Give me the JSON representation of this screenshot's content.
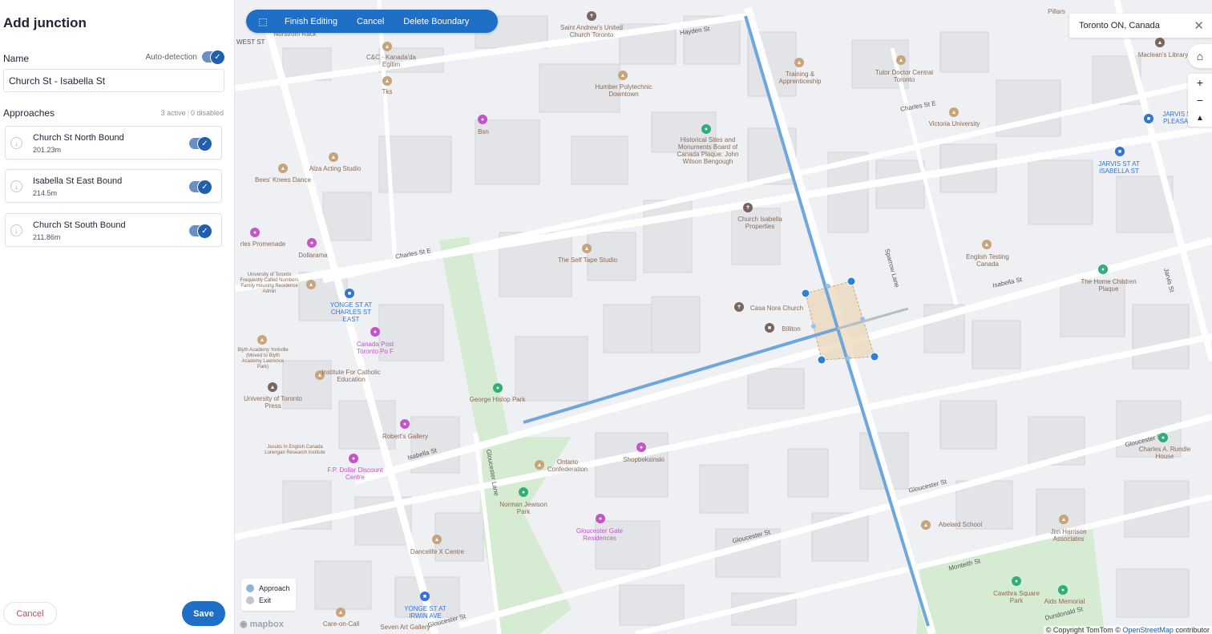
{
  "sidebar": {
    "title": "Add junction",
    "name_label": "Name",
    "auto_detection_label": "Auto-detection",
    "name_value": "Church St - Isabella St",
    "approaches_label": "Approaches",
    "active_count": "3 active",
    "disabled_count": "0 disabled",
    "approaches": [
      {
        "name": "Church St North Bound",
        "distance": "201.23m",
        "enabled": true
      },
      {
        "name": "Isabella St East Bound",
        "distance": "214.5m",
        "enabled": true
      },
      {
        "name": "Church St South Bound",
        "distance": "211.86m",
        "enabled": true
      }
    ],
    "cancel_label": "Cancel",
    "save_label": "Save"
  },
  "toolbar": {
    "finish_label": "Finish Editing",
    "cancel_label": "Cancel",
    "delete_label": "Delete Boundary"
  },
  "search": {
    "value": "Toronto ON, Canada"
  },
  "legend": {
    "approach": "Approach",
    "exit": "Exit",
    "approach_color": "#8bb4e0",
    "exit_color": "#c4c6cb"
  },
  "attribution": {
    "mapbox": "mapbox",
    "prefix": "© Copyright TomTom ©",
    "osm": "OpenStreetMap",
    "suffix": "contributor"
  },
  "map_labels": {
    "streets": [
      "Hayden St",
      "Charles St E",
      "Charles St E",
      "Isabella St",
      "Isabella St",
      "Gloucester St",
      "Gloucester St",
      "Gloucester St",
      "Gloucester St",
      "Gloucester Lane",
      "Sparrow Lane",
      "Jarvis St",
      "Monteith St",
      "Dundonald St",
      "WEST ST"
    ],
    "places": [
      "Norstrom Rack",
      "C&C - Kanada'da Egitim",
      "Tks",
      "Saint Andrew's United Church Toronto",
      "Humber Polytechnic Downtown",
      "Bsn",
      "Historical Sites and Monuments Board of Canada Plaque: John Wilson Bengough",
      "Alza Acting Studio",
      "Bees' Knees Dance",
      "rles Promenade",
      "Dollarama",
      "University of Toronto Frequently Called Numbers Family Housing Residence Admin",
      "YONGE ST AT CHARLES ST EAST",
      "Canada Post Toronto Po F",
      "Blyth Academy Yorkville (Moved to Blyth Academy Lawrence Park)",
      "Institute For Catholic Education",
      "University of Toronto Press",
      "The Self Tape Studio",
      "Church Isabella Properties",
      "Training & Apprenticeship",
      "Tutor Doctor Central Toronto",
      "Victoria University",
      "Maclean's Library",
      "JARVIS ST AT PLEASANT R",
      "JARVIS ST AT ISABELLA ST",
      "English Testing Canada",
      "The Home Children Plaque",
      "Casa Nora Church",
      "Billiton",
      "George Hislop Park",
      "Robert's Gallery",
      "Jesuits In English Canada Lonergan Research Institute",
      "F.P. Dollar Discount Centre",
      "Ontario Confederation",
      "Shopbeksinski",
      "Norman Jewison Park",
      "Gloucester Gate Residences",
      "Abelard School",
      "Jim Harrison Associates",
      "Charles A. Rundle House",
      "Cawthra Square Park",
      "Aids Memorial",
      "Dancelife X Centre",
      "YONGE ST AT IRWIN AVE",
      "Care-on-Call",
      "Seven Art Gallery",
      "Pillars"
    ]
  }
}
